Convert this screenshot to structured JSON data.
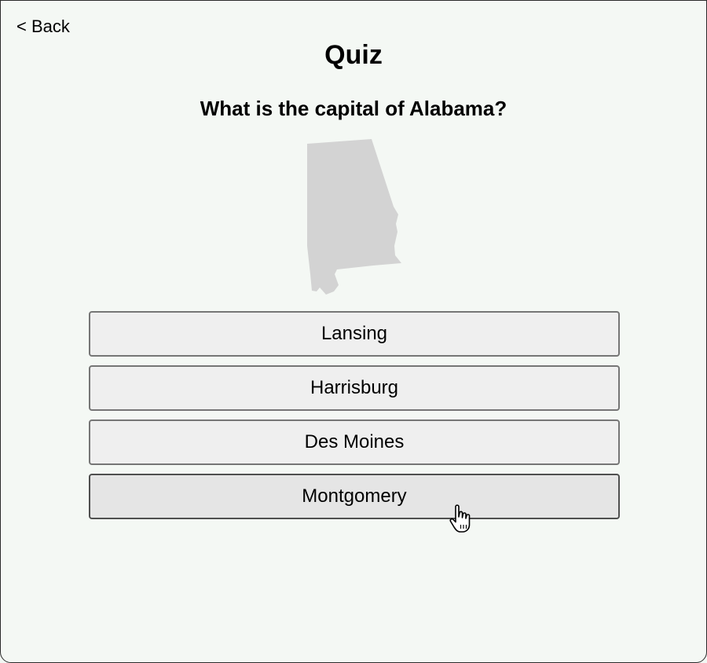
{
  "nav": {
    "back_label": "< Back"
  },
  "page": {
    "title": "Quiz",
    "question": "What is the capital of Alabama?"
  },
  "map": {
    "state": "Alabama",
    "fill_color": "#d3d3d3"
  },
  "answers": [
    {
      "label": "Lansing"
    },
    {
      "label": "Harrisburg"
    },
    {
      "label": "Des Moines"
    },
    {
      "label": "Montgomery",
      "state": "hover"
    }
  ],
  "cursor": {
    "icon": "pointer-hand-icon"
  },
  "colors": {
    "background": "#f4f8f4",
    "button_bg": "#efefef",
    "button_hover_bg": "#e5e5e5",
    "button_border": "#767676"
  }
}
